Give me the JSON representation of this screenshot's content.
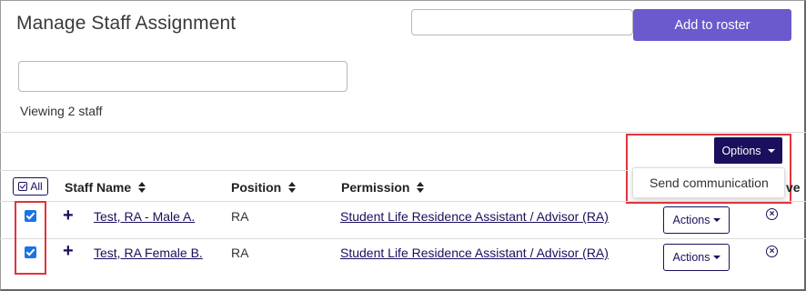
{
  "header": {
    "title": "Manage Staff Assignment",
    "top_input_value": "",
    "add_button_label": "Add to roster"
  },
  "search": {
    "value": "",
    "placeholder": ""
  },
  "viewing_text": "Viewing 2 staff",
  "options": {
    "button_label": "Options",
    "menu_items": [
      "Send communication"
    ]
  },
  "table": {
    "select_all_label": "All",
    "columns": [
      {
        "label": "Staff Name",
        "sortable": true
      },
      {
        "label": "Position",
        "sortable": true
      },
      {
        "label": "Permission",
        "sortable": true
      },
      {
        "label": "ve",
        "sortable": false
      }
    ],
    "rows": [
      {
        "checked": true,
        "name": "Test, RA - Male A.",
        "position": "RA",
        "permission": "Student Life Residence Assistant / Advisor (RA)",
        "actions_label": "Actions"
      },
      {
        "checked": true,
        "name": "Test, RA Female B.",
        "position": "RA",
        "permission": "Student Life Residence Assistant / Advisor (RA)",
        "actions_label": "Actions"
      }
    ]
  },
  "colors": {
    "primary_purple": "#6a5acd",
    "navy": "#1a0f5c",
    "checkbox_blue": "#1a73e8",
    "highlight_red": "#e0343c"
  }
}
